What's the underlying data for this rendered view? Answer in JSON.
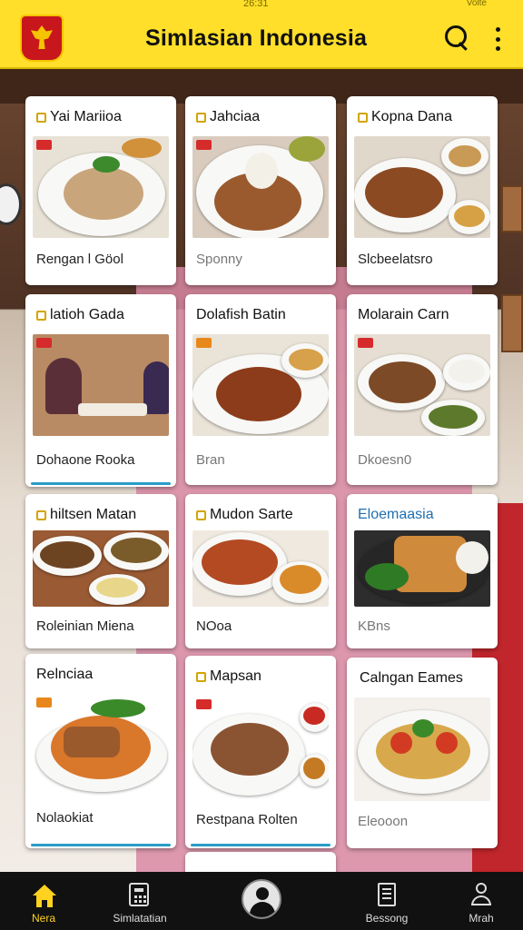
{
  "status": {
    "time": "26:31",
    "signal": "Volte"
  },
  "header": {
    "title": "Simlasian Indonesia"
  },
  "cards": [
    {
      "title": "Yai Mariioa",
      "footer": "Rengan l Göol",
      "badge": ""
    },
    {
      "title": "Jahciaa",
      "footer": "Sponny",
      "badge": ""
    },
    {
      "title": "Kopna Dana",
      "footer": "Slcbeelatsro",
      "badge": ""
    },
    {
      "title": "latioh Gada",
      "footer": "Dohaone Rooka",
      "badge": ""
    },
    {
      "title": "Dolafish Batin",
      "footer": "Bran",
      "badge": ""
    },
    {
      "title": "Molarain Carn",
      "footer": "Dkoesn0",
      "badge": ""
    },
    {
      "title": "hiltsen Matan",
      "footer": "Roleinian Miena",
      "badge": ""
    },
    {
      "title": "Mudon Sarte",
      "footer": "NOoa",
      "badge": ""
    },
    {
      "title": "Eloemaasia",
      "footer": "KBns",
      "badge": ""
    },
    {
      "title": "Relnciaa",
      "footer": "Nolaokiat",
      "badge": ""
    },
    {
      "title": "Mapsan",
      "footer": "Restpana Rolten",
      "badge": ""
    },
    {
      "title": "Calngan Eames",
      "footer": "Eleooon",
      "badge": ""
    }
  ],
  "tabs": [
    {
      "label": "Nera",
      "icon": "home-icon",
      "active": true
    },
    {
      "label": "Simlatatian",
      "icon": "calculator-icon",
      "active": false
    },
    {
      "label": "",
      "icon": "avatar-icon",
      "active": false
    },
    {
      "label": "Bessong",
      "icon": "document-icon",
      "active": false
    },
    {
      "label": "Mrah",
      "icon": "person-icon",
      "active": false
    }
  ],
  "colors": {
    "accent": "#ffdf2a",
    "tabbar": "#111111",
    "progress": "#2a9cc8"
  }
}
